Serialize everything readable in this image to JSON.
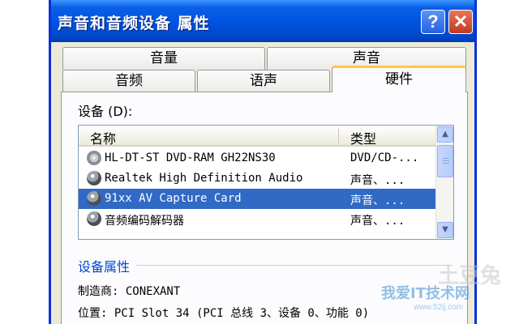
{
  "window": {
    "title": "声音和音频设备 属性",
    "help_label": "?",
    "close_label": "✕"
  },
  "tabs": {
    "row1": [
      "音量",
      "声音"
    ],
    "row2": [
      "音频",
      "语声",
      "硬件"
    ],
    "active": "硬件"
  },
  "devices": {
    "label": "设备 (D):",
    "columns": {
      "name": "名称",
      "type": "类型"
    },
    "rows": [
      {
        "icon": "dvd-drive-icon",
        "name": "HL-DT-ST DVD-RAM GH22NS30",
        "type": "DVD/CD-..."
      },
      {
        "icon": "speaker-icon",
        "name": "Realtek High Definition Audio",
        "type": "声音、..."
      },
      {
        "icon": "speaker-icon",
        "name": "91xx AV Capture Card",
        "type": "声音、...",
        "selected": true
      },
      {
        "icon": "speaker-icon",
        "name": "音频编码解码器",
        "type": "声音、..."
      }
    ]
  },
  "properties": {
    "title": "设备属性",
    "manufacturer": "制造商: CONEXANT",
    "location": "位置: PCI Slot 34 (PCI 总线 3、设备 0、功能 0)"
  },
  "watermark": {
    "text": "我爱IT技术网",
    "url": "www.52ij.com",
    "logo": "土豆兔"
  },
  "colors": {
    "title_bar": "#0054e3",
    "selection": "#316ac5",
    "group_title": "#0046d5",
    "active_tab_accent": "#ffc83c"
  }
}
